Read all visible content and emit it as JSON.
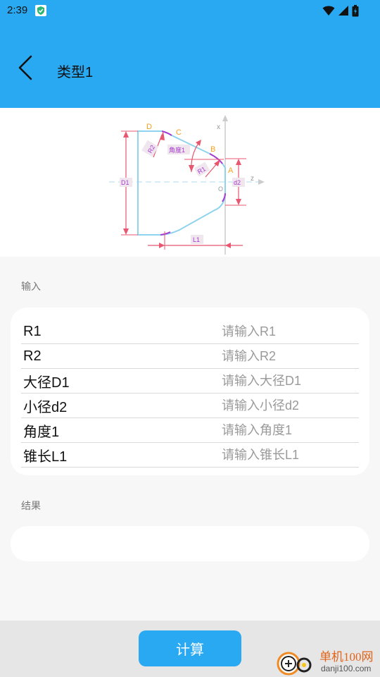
{
  "status": {
    "time": "2:39",
    "icons": [
      "shield-app-icon",
      "wifi-icon",
      "signal-icon",
      "battery-icon"
    ]
  },
  "header": {
    "title": "类型1",
    "back_icon": "chevron-left-icon"
  },
  "diagram": {
    "labels": {
      "D": "D",
      "C": "C",
      "B": "B",
      "A": "A",
      "O": "O",
      "x": "x",
      "z": "z",
      "R1": "R1",
      "R2": "R2",
      "angle": "角度1",
      "D1": "D1",
      "d2": "d2",
      "L1": "L1"
    }
  },
  "input_section": {
    "label": "输入",
    "fields": [
      {
        "label": "R1",
        "value": "",
        "placeholder": "请输入R1"
      },
      {
        "label": "R2",
        "value": "",
        "placeholder": "请输入R2"
      },
      {
        "label": "大径D1",
        "value": "",
        "placeholder": "请输入大径D1"
      },
      {
        "label": "小径d2",
        "value": "",
        "placeholder": "请输入小径d2"
      },
      {
        "label": "角度1",
        "value": "",
        "placeholder": "请输入角度1"
      },
      {
        "label": "锥长L1",
        "value": "",
        "placeholder": "请输入锥长L1"
      }
    ]
  },
  "result_section": {
    "label": "结果",
    "value": ""
  },
  "footer": {
    "calc_label": "计算"
  },
  "watermark": {
    "title": "单机100网",
    "url": "danji100.com"
  },
  "colors": {
    "accent": "#2aa9f3",
    "dimension_red": "#e8566f",
    "profile_blue": "#8fd3ee",
    "label_orange": "#f5a020",
    "label_purple": "#a63bd1"
  }
}
